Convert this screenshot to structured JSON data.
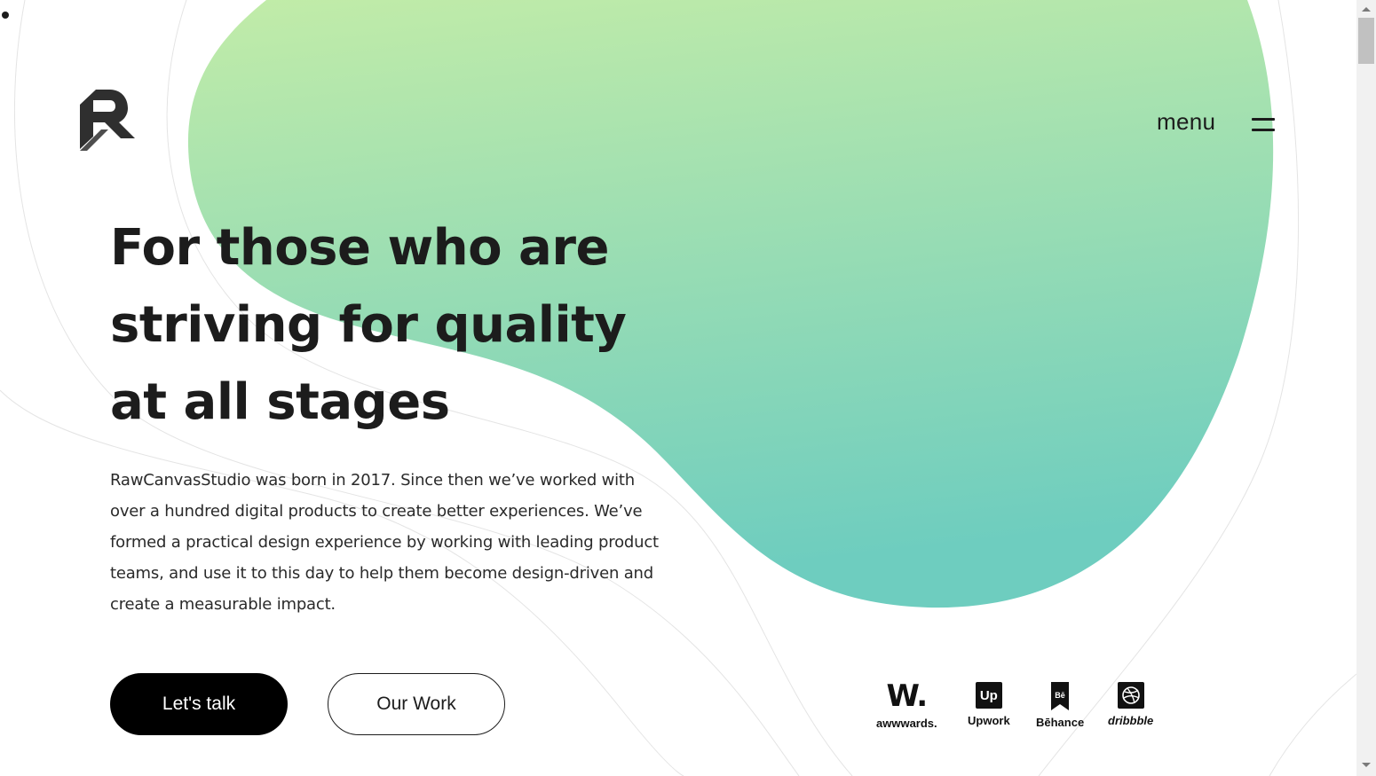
{
  "header": {
    "logo_alt": "RawCanvasStudio logo",
    "menu_label": "menu"
  },
  "hero": {
    "headline_lines": [
      "For those who are",
      "striving for quality",
      "at all stages"
    ],
    "intro": "RawCanvasStudio was born in 2017. Since then we’ve worked with over a hundred digital products to create better experiences. We’ve formed a practical design experience by working with leading product teams, and use it to this day to help them become design-driven and create a measurable impact.",
    "primary_button": "Let's talk",
    "secondary_button": "Our Work"
  },
  "badges": [
    {
      "name": "awwwards",
      "mark": "W.",
      "caption": "awwwards."
    },
    {
      "name": "upwork",
      "mark": "Up",
      "caption": "Upwork"
    },
    {
      "name": "behance",
      "mark": "Bē",
      "caption": "Bēhance"
    },
    {
      "name": "dribbble",
      "mark": "",
      "caption": "dribbble"
    }
  ],
  "colors": {
    "blob_top": "#c2eca8",
    "blob_bottom": "#6ecdbf",
    "text": "#1c1c1c",
    "primary_button_bg": "#000000"
  }
}
